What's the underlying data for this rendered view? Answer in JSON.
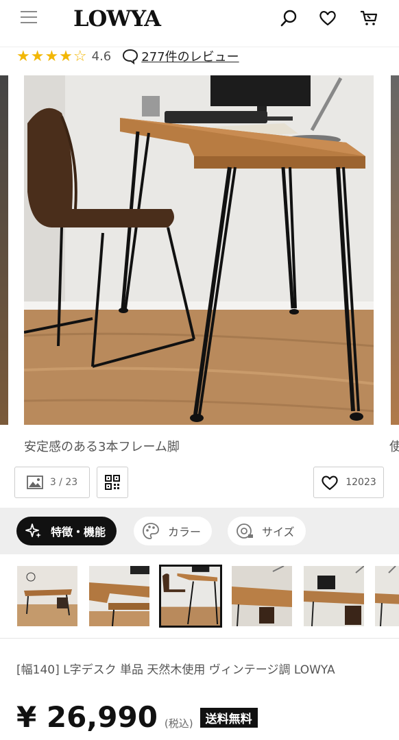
{
  "header": {
    "logo": "LOWYA",
    "icons": [
      "menu-icon",
      "search-icon",
      "heart-icon",
      "cart-icon"
    ]
  },
  "rating": {
    "stars": "★★★★☆",
    "value": "4.6",
    "reviews": "277件のレビュー",
    "star_color": "#f2b705"
  },
  "gallery": {
    "caption": "安定感のある3本フレーム脚",
    "next_caption_peek": "使",
    "counter": "3 / 23",
    "favorites": "12023"
  },
  "tabs": [
    {
      "label": "特徴・機能",
      "icon": "sparkle-icon",
      "active": true
    },
    {
      "label": "カラー",
      "icon": "palette-icon",
      "active": false
    },
    {
      "label": "サイズ",
      "icon": "measure-icon",
      "active": false
    }
  ],
  "thumbnails": {
    "count": 7,
    "selected_index": 2
  },
  "product": {
    "name": "[幅140] L字デスク 単品 天然木使用 ヴィンテージ調 LOWYA",
    "price": "¥ 26,990",
    "tax_note": "(税込)",
    "shipping_badge": "送料無料"
  }
}
